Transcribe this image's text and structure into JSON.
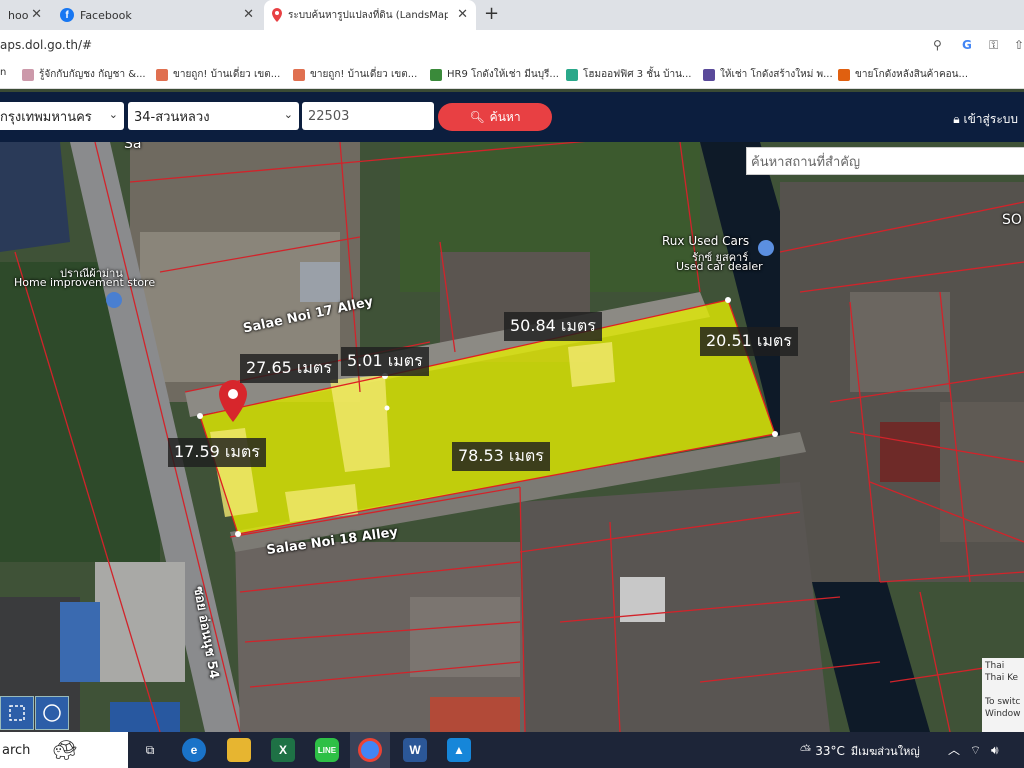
{
  "tabs": [
    {
      "label": "hoo",
      "active": false
    },
    {
      "label": "Facebook",
      "active": false
    },
    {
      "label": "ระบบค้นหารูปแปลงที่ดิน (LandsMaps)",
      "active": true
    }
  ],
  "new_tab": "+",
  "address": {
    "url": "aps.dol.go.th/#"
  },
  "bookmarks": [
    {
      "label": "n"
    },
    {
      "label": "รู้จักกับกัญชง กัญชา &..."
    },
    {
      "label": "ขายถูก! บ้านเดี่ยว เขต..."
    },
    {
      "label": "ขายถูก! บ้านเดี่ยว เขต..."
    },
    {
      "label": "HR9 โกดังให้เช่า มีนบุรี..."
    },
    {
      "label": "โฮมออฟฟิศ 3 ชั้น บ้าน..."
    },
    {
      "label": "ให้เช่า โกดังสร้างใหม่ พ..."
    },
    {
      "label": "ขายโกดังหลังสินค้าคอน..."
    }
  ],
  "site": {
    "province": "กรุงเทพมหานคร",
    "district": "34-สวนหลวง",
    "parcel_no": "22503",
    "search_label": "ค้นหา",
    "login_label": "เข้าสู่ระบบ",
    "brand_color": "#0c1e3e",
    "accent_color": "#e84043"
  },
  "map": {
    "poi_search_placeholder": "ค้นหาสถานที่สำคัญ",
    "parcel_fill_color": "#e6f000",
    "boundary_color": "#d2232a",
    "measurements": [
      {
        "label": "50.84 เมตร"
      },
      {
        "label": "20.51 เมตร"
      },
      {
        "label": "27.65 เมตร"
      },
      {
        "label": "5.01 เมตร"
      },
      {
        "label": "78.53 เมตร"
      },
      {
        "label": "17.59 เมตร"
      }
    ],
    "roads": [
      "Salae Noi 17 Alley",
      "Salae Noi 18 Alley",
      "ซอย อ่อนนุช 54"
    ],
    "places": [
      {
        "name": "Rux Used Cars",
        "sub1": "รักซ์ ยูสคาร์",
        "sub2": "Used car dealer"
      },
      {
        "name": "ปราณีผ้าม่าน",
        "sub1": "Home improvement store"
      }
    ],
    "edge_labels": [
      "SO",
      "Sa"
    ],
    "notice": [
      "Thai",
      "Thai Ke",
      "To switc",
      "Window"
    ]
  },
  "taskbar": {
    "search_label": "arch",
    "weather_temp": "33°C",
    "weather_text": "มีเมฆส่วนใหญ่"
  }
}
